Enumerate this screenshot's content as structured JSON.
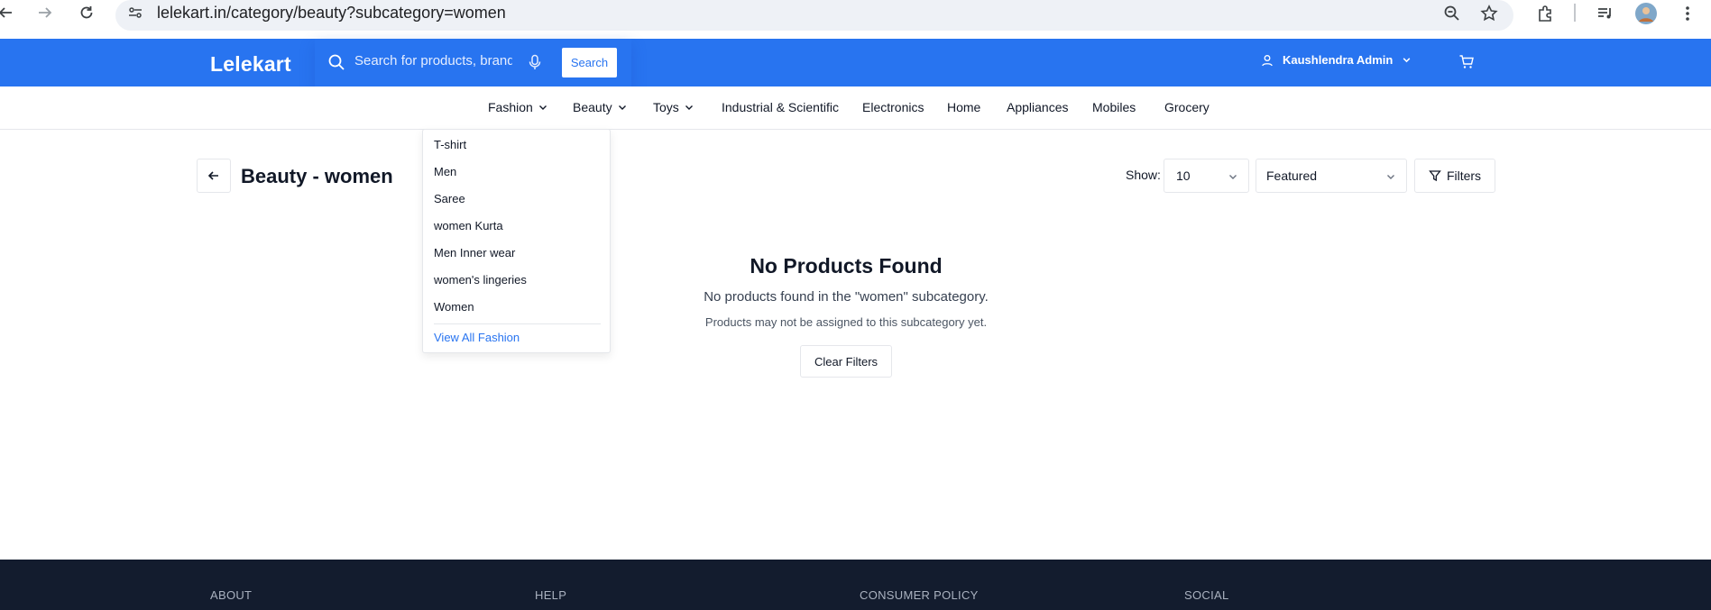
{
  "browser": {
    "url": "lelekart.in/category/beauty?subcategory=women"
  },
  "header": {
    "logo": "Lelekart",
    "search_placeholder": "Search for products, brands and more",
    "search_button": "Search",
    "user_name": "Kaushlendra Admin"
  },
  "categories": [
    {
      "label": "Fashion",
      "has_dropdown": true
    },
    {
      "label": "Beauty",
      "has_dropdown": true
    },
    {
      "label": "Toys",
      "has_dropdown": true
    },
    {
      "label": "Industrial & Scientific",
      "has_dropdown": false
    },
    {
      "label": "Electronics",
      "has_dropdown": false
    },
    {
      "label": "Home",
      "has_dropdown": false
    },
    {
      "label": "Appliances",
      "has_dropdown": false
    },
    {
      "label": "Mobiles",
      "has_dropdown": false
    },
    {
      "label": "Grocery",
      "has_dropdown": false
    }
  ],
  "dropdown": {
    "items": [
      "T-shirt",
      "Men",
      "Saree",
      "women Kurta",
      "Men Inner wear",
      "women's lingeries",
      "Women"
    ],
    "view_all": "View All Fashion"
  },
  "page": {
    "title": "Beauty - women",
    "show_label": "Show:",
    "show_value": "10",
    "sort_value": "Featured",
    "filters_label": "Filters"
  },
  "empty": {
    "title": "No Products Found",
    "message": "No products found in the \"women\" subcategory.",
    "sub": "Products may not be assigned to this subcategory yet.",
    "clear_button": "Clear Filters"
  },
  "footer": {
    "headings": [
      "ABOUT",
      "HELP",
      "CONSUMER POLICY",
      "SOCIAL"
    ]
  },
  "colors": {
    "brand": "#2874f0",
    "footer_bg": "#131c2e"
  }
}
